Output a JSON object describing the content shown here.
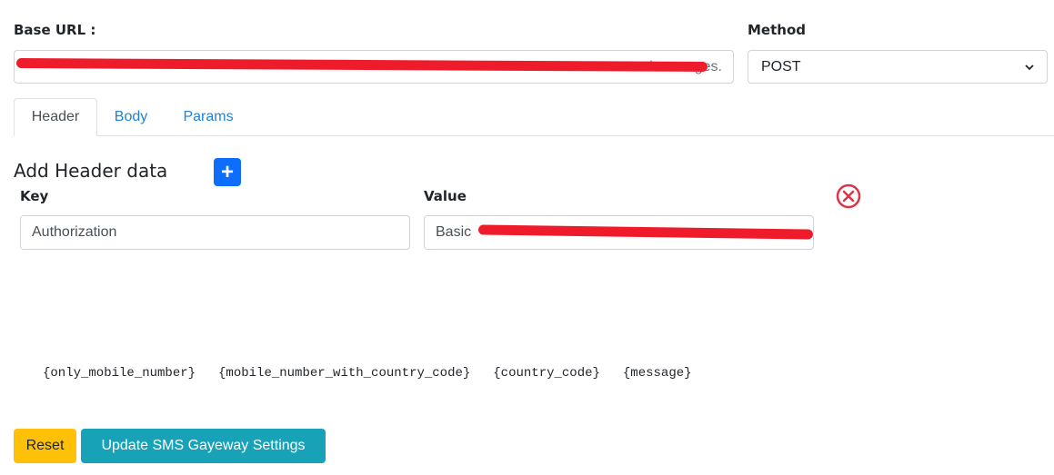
{
  "base_url": {
    "label": "Base URL :",
    "value_prefix": "",
    "value_suffix": "/messages."
  },
  "method": {
    "label": "Method",
    "selected": "POST"
  },
  "tabs": [
    {
      "label": "Header",
      "active": true
    },
    {
      "label": "Body",
      "active": false
    },
    {
      "label": "Params",
      "active": false
    }
  ],
  "header_section": {
    "title": "Add Header data",
    "add_icon": "plus-icon",
    "add_label": "+",
    "key_label": "Key",
    "value_label": "Value",
    "rows": [
      {
        "key": "Authorization",
        "value_prefix": "Basic "
      }
    ],
    "remove_icon": "close-circle-icon"
  },
  "placeholders": [
    "{only_mobile_number}",
    "{mobile_number_with_country_code}",
    "{country_code}",
    "{message}"
  ],
  "actions": {
    "reset_label": "Reset",
    "update_label": "Update SMS Gayeway Settings"
  },
  "colors": {
    "primary": "#0d6efd",
    "link": "#1f82d6",
    "warning": "#ffc107",
    "info": "#17a2b8",
    "danger": "#dc3545",
    "redaction": "#ee1c2b"
  }
}
